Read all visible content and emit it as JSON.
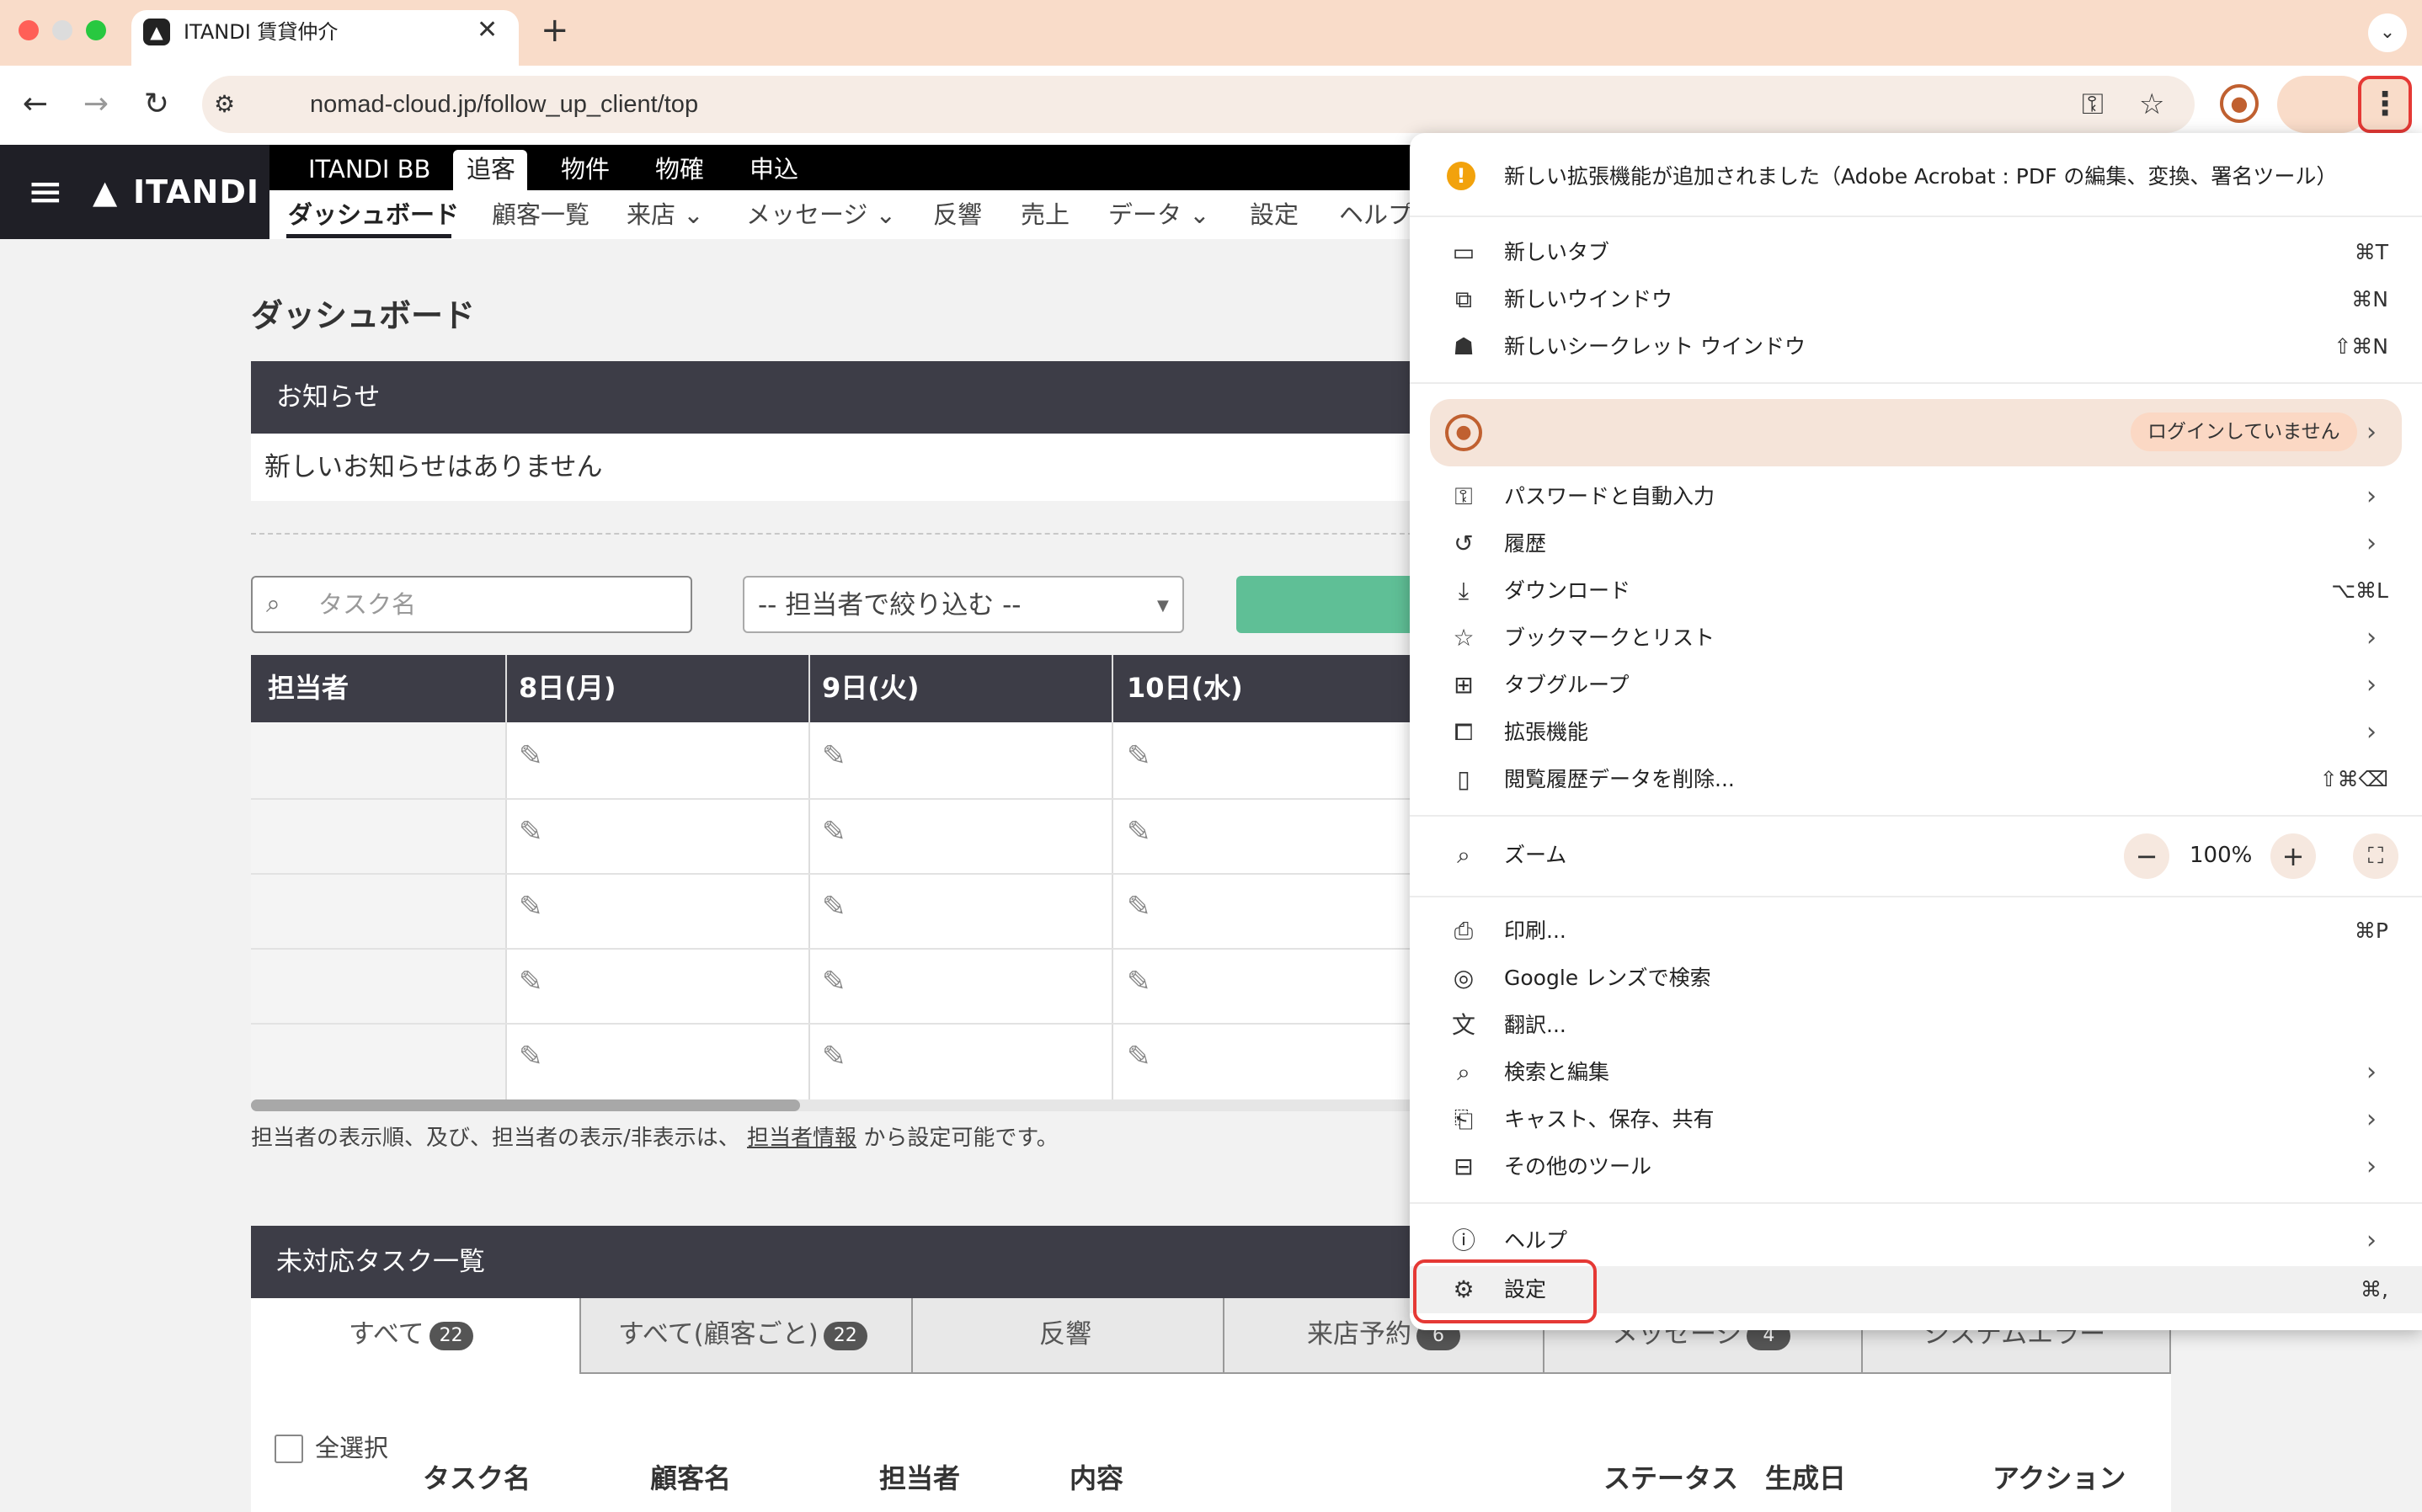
{
  "browser": {
    "tab_title": "ITANDI 賃貸仲介",
    "tab_close": "✕",
    "new_tab": "+",
    "tab_dropdown": "⌄",
    "url": "nomad-cloud.jp/follow_up_client/top"
  },
  "site": {
    "logo_text": "ITANDI",
    "top_nav": [
      "ITANDI BB",
      "追客",
      "物件",
      "物確",
      "申込"
    ],
    "active_top_nav": "追客",
    "sub_nav": [
      "ダッシュボード",
      "顧客一覧",
      "来店 ⌄",
      "メッセージ ⌄",
      "反響",
      "売上",
      "データ ⌄",
      "設定",
      "ヘルプ"
    ]
  },
  "page": {
    "title": "ダッシュボード",
    "notice_header": "お知らせ",
    "notice_text": "新しいお知らせはありません",
    "search_placeholder": "タスク名",
    "assignee_filter": "-- 担当者で絞り込む --",
    "grid_headers": [
      "担当者",
      "8日(月)",
      "9日(火)",
      "10日(水)"
    ],
    "hint_before": "担当者の表示順、及び、担当者の表示/非表示は、",
    "hint_link": "担当者情報",
    "hint_after": "から設定可能です。",
    "tasks_header": "未対応タスク一覧",
    "task_tabs": [
      {
        "label": "すべて",
        "badge": "22"
      },
      {
        "label": "すべて(顧客ごと)",
        "badge": "22"
      },
      {
        "label": "反響",
        "badge": ""
      },
      {
        "label": "来店予約",
        "badge": "6"
      },
      {
        "label": "メッセージ",
        "badge": "4"
      },
      {
        "label": "システムエラー",
        "badge": ""
      }
    ],
    "select_all": "全選択",
    "task_columns": [
      "タスク名",
      "顧客名",
      "担当者",
      "内容",
      "ステータス",
      "生成日",
      "アクション"
    ]
  },
  "menu": {
    "extension_notice": "新しい拡張機能が追加されました（Adobe Acrobat : PDF の編集、変換、署名ツール）",
    "new_tab": {
      "label": "新しいタブ",
      "shortcut": "⌘T"
    },
    "new_window": {
      "label": "新しいウインドウ",
      "shortcut": "⌘N"
    },
    "incognito": {
      "label": "新しいシークレット ウインドウ",
      "shortcut": "⇧⌘N"
    },
    "profile_status": "ログインしていません",
    "passwords": "パスワードと自動入力",
    "history": "履歴",
    "downloads": {
      "label": "ダウンロード",
      "shortcut": "⌥⌘L"
    },
    "bookmarks": "ブックマークとリスト",
    "tab_groups": "タブグループ",
    "extensions": "拡張機能",
    "clear_data": {
      "label": "閲覧履歴データを削除...",
      "shortcut": "⇧⌘⌫"
    },
    "zoom": {
      "label": "ズーム",
      "value": "100%",
      "minus": "−",
      "plus": "+"
    },
    "print": {
      "label": "印刷...",
      "shortcut": "⌘P"
    },
    "lens": "Google レンズで検索",
    "translate": "翻訳...",
    "find_edit": "検索と編集",
    "cast": "キャスト、保存、共有",
    "more_tools": "その他のツール",
    "help": "ヘルプ",
    "settings": {
      "label": "設定",
      "shortcut": "⌘,"
    }
  }
}
